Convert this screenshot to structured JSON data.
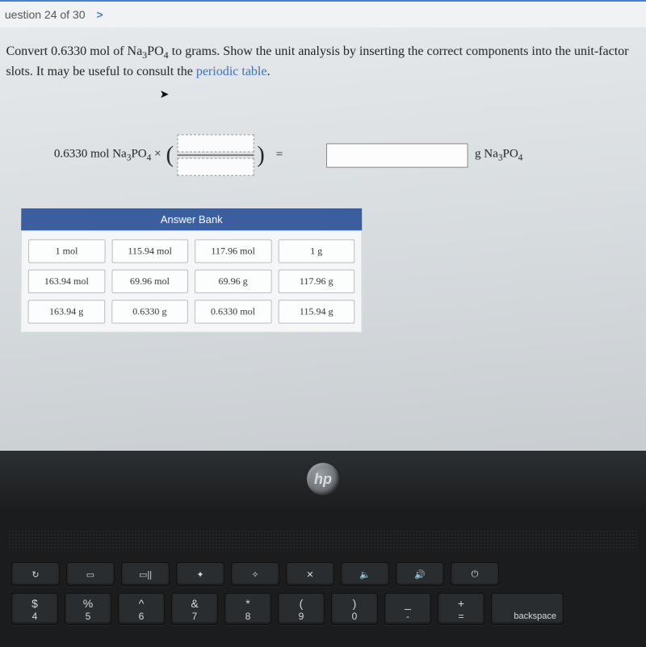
{
  "header": {
    "question_label": "uestion 24 of 30",
    "chevron": ">"
  },
  "prompt": {
    "line1_a": "Convert 0.6330 mol of Na",
    "line1_b": "PO",
    "line1_c": " to grams. Show the unit analysis by inserting the correct components into the unit-factor",
    "line2_a": "slots. It may be useful to consult the ",
    "link": "periodic table",
    "line2_b": "."
  },
  "equation": {
    "given_a": "0.6330 mol Na",
    "given_b": "PO",
    "times": " × ",
    "equals": "=",
    "unit_a": "g Na",
    "unit_b": "PO"
  },
  "bank": {
    "title": "Answer Bank",
    "tiles": [
      "1 mol",
      "115.94 mol",
      "117.96 mol",
      "1 g",
      "163.94 mol",
      "69.96 mol",
      "69.96 g",
      "117.96 g",
      "163.94 g",
      "0.6330 g",
      "0.6330 mol",
      "115.94 g"
    ]
  },
  "laptop": {
    "logo": "hp",
    "fn_row": [
      "↻",
      "▭",
      "▭||",
      "✦",
      "✧",
      "✕",
      "🔈",
      "🔊",
      "⏻"
    ],
    "num_row": [
      {
        "top": "$",
        "bot": "4"
      },
      {
        "top": "%",
        "bot": "5"
      },
      {
        "top": "^",
        "bot": "6"
      },
      {
        "top": "&",
        "bot": "7"
      },
      {
        "top": "*",
        "bot": "8"
      },
      {
        "top": "(",
        "bot": "9"
      },
      {
        "top": ")",
        "bot": "0"
      },
      {
        "top": "_",
        "bot": "-"
      },
      {
        "top": "+",
        "bot": "="
      }
    ],
    "backspace": "backspace"
  }
}
